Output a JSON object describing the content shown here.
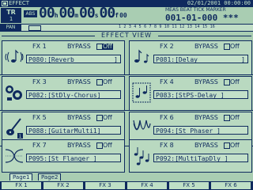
{
  "title_bar": {
    "title": "EFFECT",
    "datetime": "02/01/2001 00:00:00"
  },
  "track": {
    "label": "TR",
    "number": "1"
  },
  "counter": {
    "abs_label": "ABS",
    "hours": "00",
    "h": "h",
    "minutes": "00",
    "m": "m",
    "seconds": "00",
    "s": "s",
    "frames": "00",
    "f": "f",
    "sub": "00"
  },
  "meas_header": "MEAS BEAT TICK MARKER",
  "meas_value": "001-01-000  ***",
  "pan": {
    "label": "PAN",
    "numbers": "1 2 3 4 5 6 7 8 9 10 11 12 13 14 15 16"
  },
  "view_title": "EFFECT VIEW",
  "effects": [
    {
      "name": "FX 1",
      "bypass": "BYPASS",
      "state": "Off",
      "highlight": true,
      "program": "P080:[Reverb",
      "bracket": "]",
      "icon": "reverb-icon"
    },
    {
      "name": "FX 2",
      "bypass": "BYPASS",
      "state": "Off",
      "highlight": false,
      "program": "P081:[Delay",
      "bracket": "]",
      "icon": "delay-icon"
    },
    {
      "name": "FX 3",
      "bypass": "BYPASS",
      "state": "Off",
      "highlight": false,
      "program": "P082:[StDly-Chorus]",
      "bracket": "",
      "icon": "chorus-icon"
    },
    {
      "name": "FX 4",
      "bypass": "BYPASS",
      "state": "Off",
      "highlight": false,
      "program": "P083:[StPS-Delay ]",
      "bracket": "",
      "icon": "pitch-shift-delay-icon"
    },
    {
      "name": "FX 5",
      "bypass": "BYPASS",
      "state": "Off",
      "highlight": false,
      "program": "P088:[GuitarMulti1]",
      "bracket": "",
      "icon": "guitar-multi-icon"
    },
    {
      "name": "FX 6",
      "bypass": "BYPASS",
      "state": "Off",
      "highlight": false,
      "program": "P094:[St Phaser ]",
      "bracket": "",
      "icon": "phaser-icon"
    },
    {
      "name": "FX 7",
      "bypass": "BYPASS",
      "state": "Off",
      "highlight": false,
      "program": "P095:[St Flanger ]",
      "bracket": "",
      "icon": "flanger-icon"
    },
    {
      "name": "FX 8",
      "bypass": "BYPASS",
      "state": "Off",
      "highlight": false,
      "program": "P092:[MultiTapDly ]",
      "bracket": "",
      "icon": "multi-tap-delay-icon"
    }
  ],
  "tabs": [
    "Page1",
    "Page2"
  ],
  "function_keys": [
    "FX 1",
    "FX 2",
    "FX 3",
    "FX 4",
    "FX 5",
    "FX 6"
  ],
  "colors": {
    "ink": "#0f2a5e",
    "background": "#a9cdb2",
    "panel": "#b9d9c0"
  }
}
